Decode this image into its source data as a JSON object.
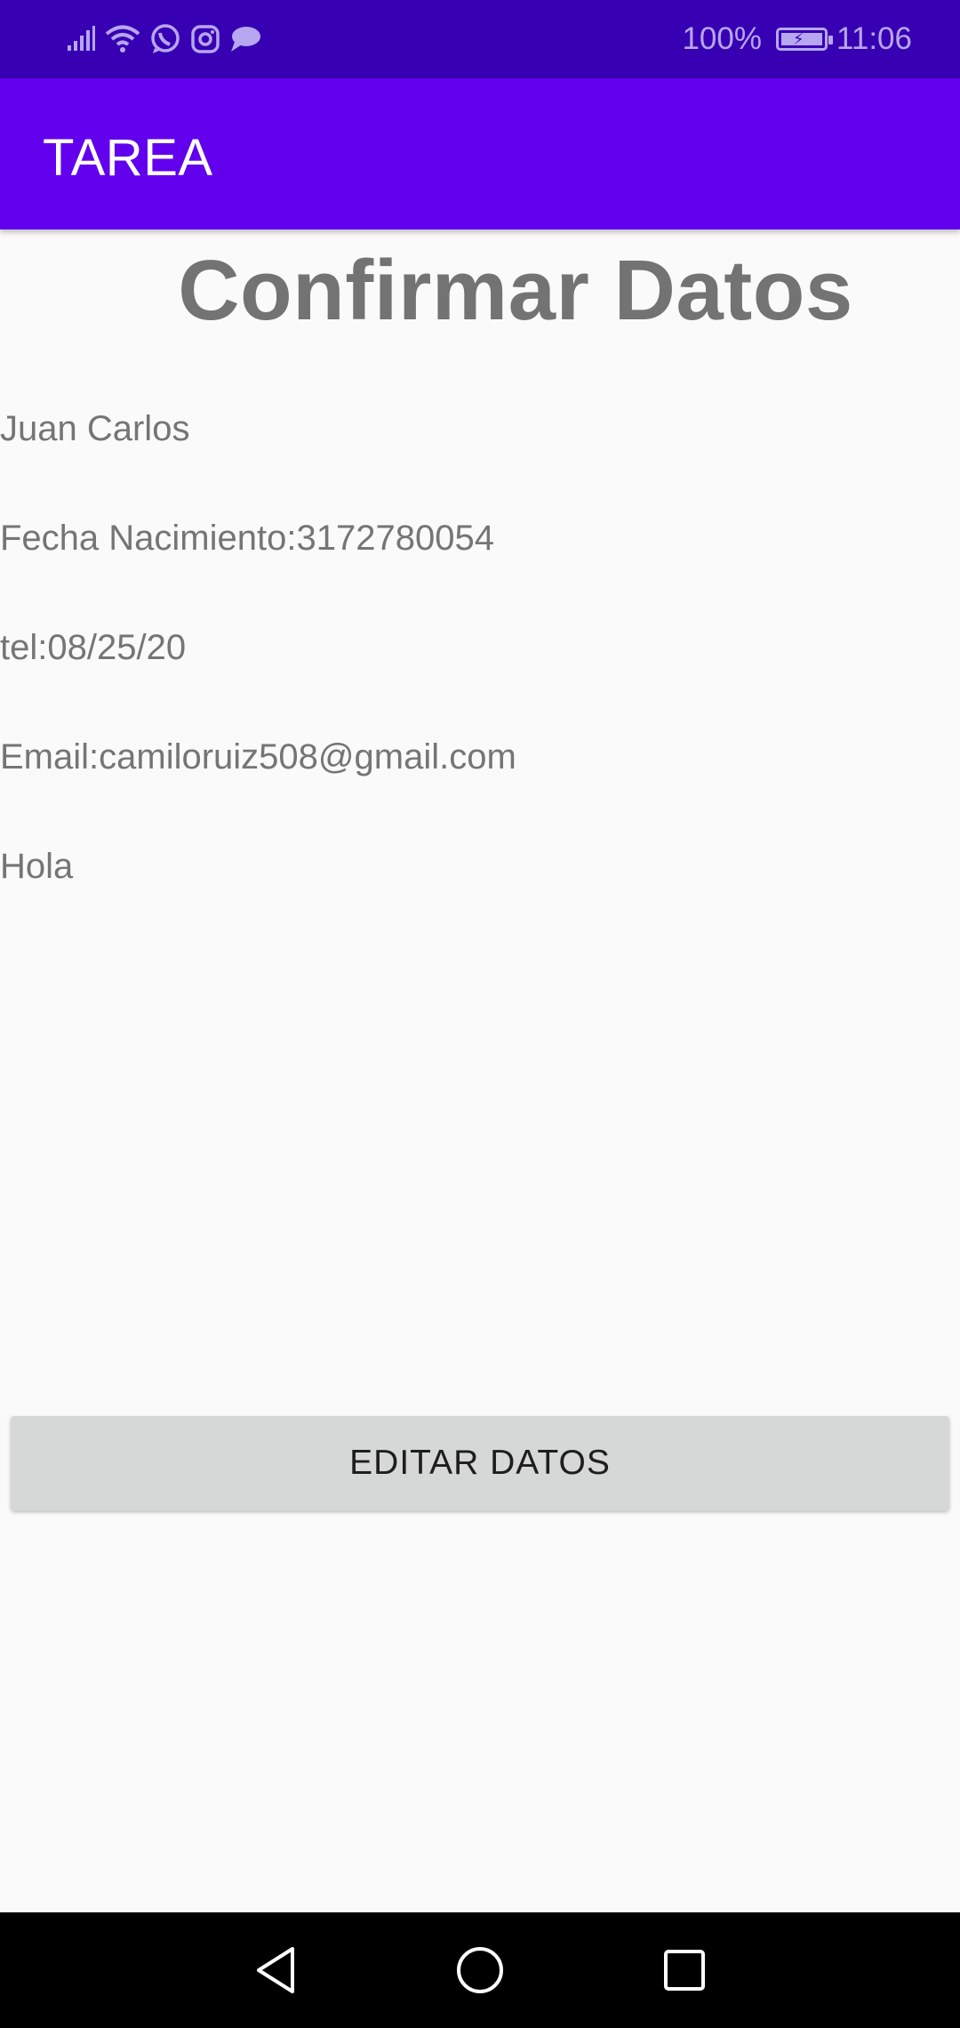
{
  "status_bar": {
    "icons": [
      "signal-icon",
      "wifi-icon",
      "whatsapp-icon",
      "instagram-icon",
      "message-icon"
    ],
    "battery_percent": "100%",
    "time": "11:06",
    "color": "#3700b3"
  },
  "app_bar": {
    "title": "TAREA",
    "color": "#6200ee"
  },
  "main": {
    "heading": "Confirmar Datos",
    "name": "Juan Carlos",
    "birth_date": "Fecha Nacimiento:3172780054",
    "phone": "tel:08/25/20",
    "email": "Email:camiloruiz508@gmail.com",
    "message": "Hola"
  },
  "actions": {
    "edit_label": "EDITAR DATOS"
  },
  "nav_bar": {
    "icons": [
      "back-icon",
      "home-icon",
      "recents-icon"
    ]
  }
}
